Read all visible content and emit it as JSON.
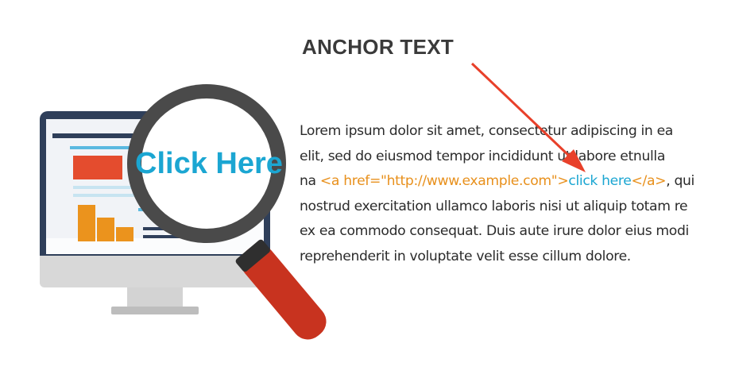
{
  "title": "ANCHOR TEXT",
  "magnifier_text": "Click Here",
  "paragraph": {
    "line1": "Lorem ipsum dolor sit amet, consectetur adipiscing in ea",
    "line2": "elit, sed do eiusmod tempor incididunt ut labore etnulla",
    "line3_prefix": "na ",
    "line3_tag_open": "<a href=\"http://www.example.com\">",
    "line3_anchor": "click here",
    "line3_tag_close": "</a>",
    "line3_suffix": ", qui",
    "line4": "nostrud exercitation ullamco laboris nisi ut aliquip totam re",
    "line5": "ex ea commodo consequat. Duis aute irure dolor eius modi",
    "line6": "reprehenderit in voluptate velit esse cillum dolore."
  },
  "colors": {
    "code": "#e8901c",
    "anchor": "#1ba6d2",
    "arrow": "#e8402a",
    "handle": "#c8331f",
    "lens_ring": "#4a4a4a"
  },
  "icons": [
    "monitor-icon",
    "magnifying-glass-icon",
    "arrow-icon"
  ]
}
